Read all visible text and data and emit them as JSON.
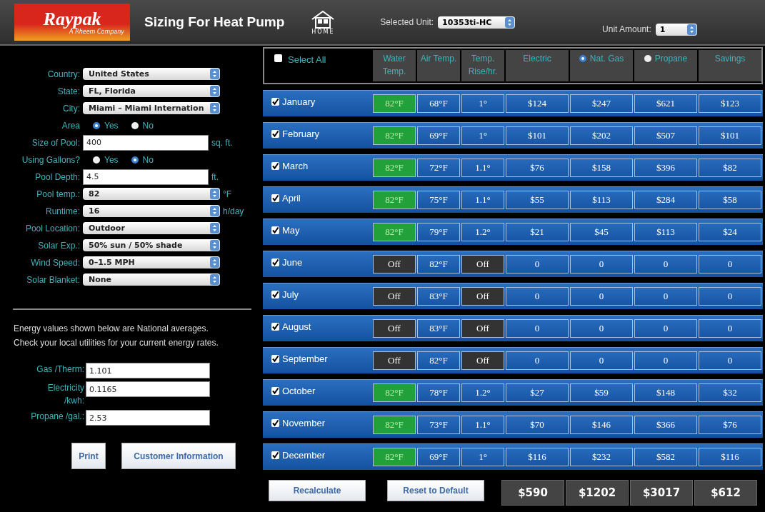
{
  "header": {
    "logo": {
      "name": "Raypak",
      "tagline": "A Rheem Company"
    },
    "title": "Sizing For Heat Pump",
    "home_label": "HOME",
    "selected_unit": {
      "label": "Selected Unit:",
      "value": "10353ti-HC"
    },
    "unit_amount": {
      "label": "Unit Amount:",
      "value": "1"
    }
  },
  "form": [
    {
      "kind": "select",
      "label": "Country:",
      "value": "United States"
    },
    {
      "kind": "select",
      "label": "State:",
      "value": "FL, Florida"
    },
    {
      "kind": "select",
      "label": "City:",
      "value": "Miami – Miami Internation"
    },
    {
      "kind": "radio",
      "label": "Area",
      "options": [
        {
          "label": "Yes",
          "selected": true
        },
        {
          "label": "No",
          "selected": false
        }
      ]
    },
    {
      "kind": "input",
      "label": "Size of Pool:",
      "value": "400",
      "unit": "sq. ft."
    },
    {
      "kind": "radio",
      "label": "Using Gallons?",
      "options": [
        {
          "label": "Yes",
          "selected": false
        },
        {
          "label": "No",
          "selected": true
        }
      ]
    },
    {
      "kind": "input",
      "label": "Pool Depth:",
      "value": "4.5",
      "unit": "ft."
    },
    {
      "kind": "select",
      "label": "Pool temp.:",
      "value": "82",
      "unit": "°F"
    },
    {
      "kind": "select",
      "label": "Runtime:",
      "value": "16",
      "unit": "h/day"
    },
    {
      "kind": "select",
      "label": "Pool Location:",
      "value": "Outdoor"
    },
    {
      "kind": "select",
      "label": "Solar Exp.:",
      "value": "50% sun / 50% shade"
    },
    {
      "kind": "select",
      "label": "Wind Speed:",
      "value": "0–1.5 MPH"
    },
    {
      "kind": "select",
      "label": "Solar Blanket:",
      "value": "None"
    }
  ],
  "energy_note": "Energy values shown below are National averages. Check your local utilities for your current energy rates.",
  "rates": [
    {
      "label": "Gas /Therm:",
      "value": "1.101"
    },
    {
      "label": "Electricity /kwh:",
      "value": "0.1165"
    },
    {
      "label": "Propane /gal.:",
      "value": "2.53"
    }
  ],
  "left_buttons": [
    "Print",
    "Customer Information"
  ],
  "table": {
    "select_all": {
      "label": "Select All",
      "checked": false
    },
    "columns": [
      {
        "label": "Water Temp."
      },
      {
        "label": "Air Temp."
      },
      {
        "label": "Temp. Rise/hr."
      },
      {
        "label": "Electric"
      },
      {
        "label": "Nat. Gas",
        "selected": true
      },
      {
        "label": "Propane",
        "selected": false
      },
      {
        "label": "Savings"
      }
    ],
    "rows": [
      {
        "month": "January",
        "checked": true,
        "heating": true,
        "water": "82°F",
        "air": "68°F",
        "rise": "1°",
        "electric": "$124",
        "gas": "$247",
        "propane": "$621",
        "savings": "$123"
      },
      {
        "month": "February",
        "checked": true,
        "heating": true,
        "water": "82°F",
        "air": "69°F",
        "rise": "1°",
        "electric": "$101",
        "gas": "$202",
        "propane": "$507",
        "savings": "$101"
      },
      {
        "month": "March",
        "checked": true,
        "heating": true,
        "water": "82°F",
        "air": "72°F",
        "rise": "1.1°",
        "electric": "$76",
        "gas": "$158",
        "propane": "$396",
        "savings": "$82"
      },
      {
        "month": "April",
        "checked": true,
        "heating": true,
        "water": "82°F",
        "air": "75°F",
        "rise": "1.1°",
        "electric": "$55",
        "gas": "$113",
        "propane": "$284",
        "savings": "$58"
      },
      {
        "month": "May",
        "checked": true,
        "heating": true,
        "water": "82°F",
        "air": "79°F",
        "rise": "1.2°",
        "electric": "$21",
        "gas": "$45",
        "propane": "$113",
        "savings": "$24"
      },
      {
        "month": "June",
        "checked": true,
        "heating": false,
        "water": "Off",
        "air": "82°F",
        "rise": "Off",
        "electric": "0",
        "gas": "0",
        "propane": "0",
        "savings": "0"
      },
      {
        "month": "July",
        "checked": true,
        "heating": false,
        "water": "Off",
        "air": "83°F",
        "rise": "Off",
        "electric": "0",
        "gas": "0",
        "propane": "0",
        "savings": "0"
      },
      {
        "month": "August",
        "checked": true,
        "heating": false,
        "water": "Off",
        "air": "83°F",
        "rise": "Off",
        "electric": "0",
        "gas": "0",
        "propane": "0",
        "savings": "0"
      },
      {
        "month": "September",
        "checked": true,
        "heating": false,
        "water": "Off",
        "air": "82°F",
        "rise": "Off",
        "electric": "0",
        "gas": "0",
        "propane": "0",
        "savings": "0"
      },
      {
        "month": "October",
        "checked": true,
        "heating": true,
        "water": "82°F",
        "air": "78°F",
        "rise": "1.2°",
        "electric": "$27",
        "gas": "$59",
        "propane": "$148",
        "savings": "$32"
      },
      {
        "month": "November",
        "checked": true,
        "heating": true,
        "water": "82°F",
        "air": "73°F",
        "rise": "1.1°",
        "electric": "$70",
        "gas": "$146",
        "propane": "$366",
        "savings": "$76"
      },
      {
        "month": "December",
        "checked": true,
        "heating": true,
        "water": "82°F",
        "air": "69°F",
        "rise": "1°",
        "electric": "$116",
        "gas": "$232",
        "propane": "$582",
        "savings": "$116"
      }
    ],
    "buttons": [
      "Recalculate",
      "Reset to Default"
    ],
    "totals": [
      "$590",
      "$1202",
      "$3017",
      "$612"
    ]
  }
}
